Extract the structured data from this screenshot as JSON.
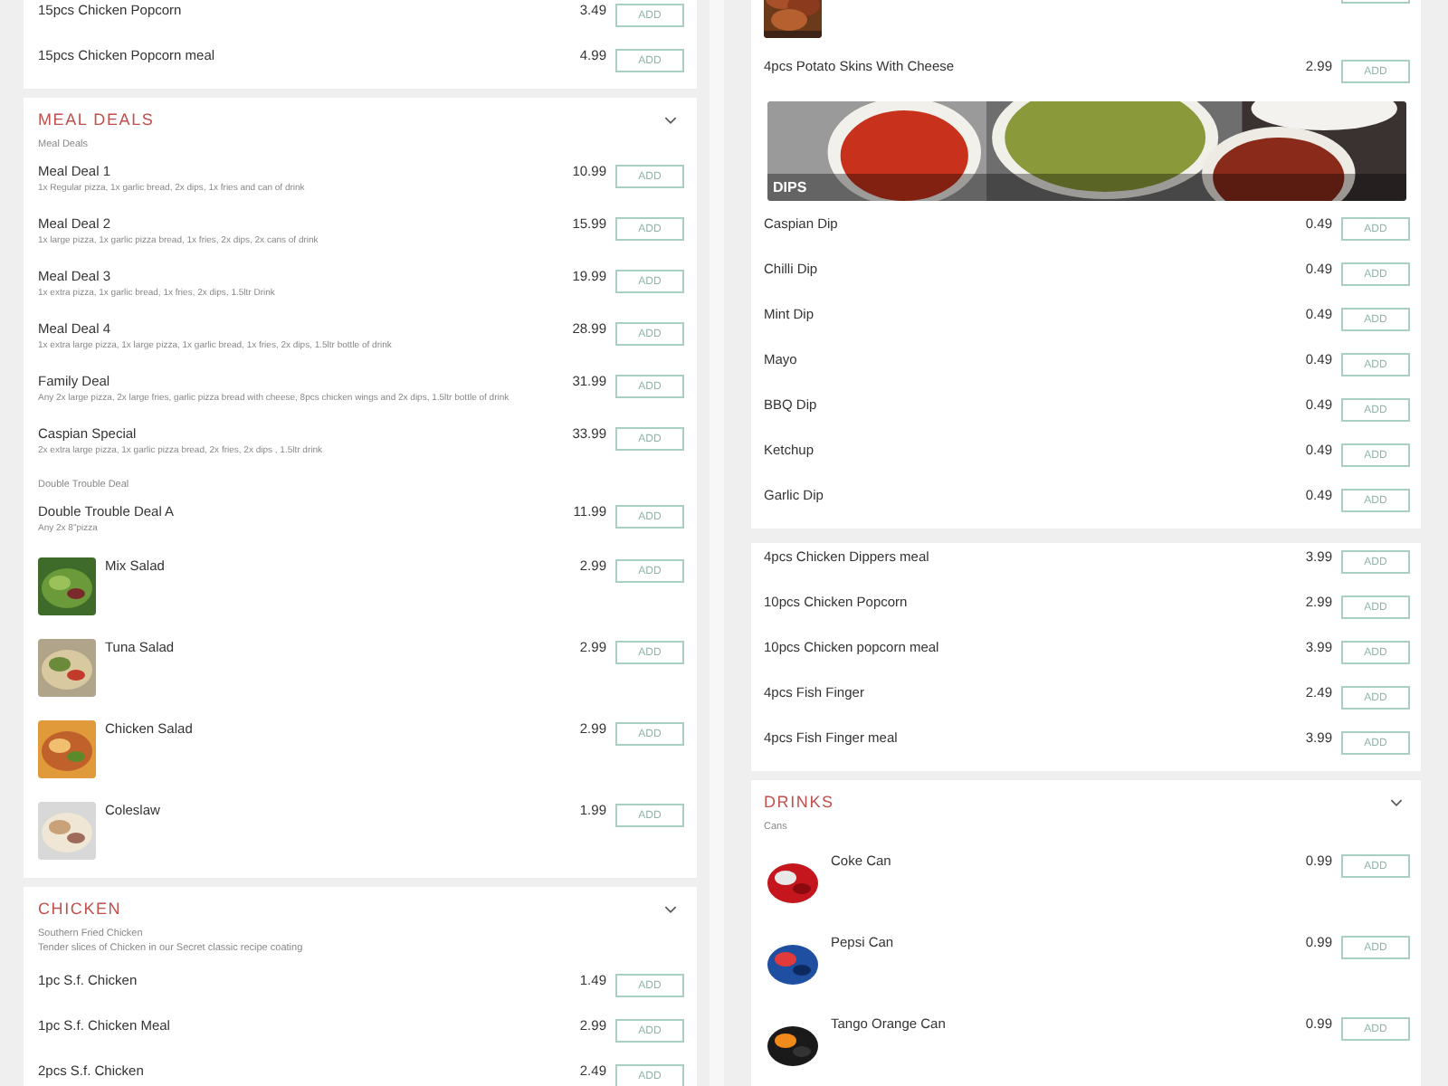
{
  "panels": [
    {
      "cards": [
        {
          "rows": [
            {
              "kind": "item",
              "name": "15pcs Chicken Popcorn",
              "price": "3.49",
              "button": "ADD"
            },
            {
              "kind": "item",
              "name": "15pcs Chicken Popcorn meal",
              "price": "4.99",
              "button": "ADD"
            }
          ]
        },
        {
          "title": "MEAL DEALS",
          "rows": [
            {
              "kind": "group",
              "text": "Meal Deals"
            },
            {
              "kind": "item",
              "name": "Meal Deal 1",
              "description": "1x Regular pizza, 1x garlic bread, 2x dips, 1x fries and can of drink",
              "price": "10.99",
              "button": "ADD"
            },
            {
              "kind": "item",
              "name": "Meal Deal 2",
              "description": "1x large pizza, 1x garlic pizza bread, 1x fries, 2x dips, 2x cans of drink",
              "price": "15.99",
              "button": "ADD"
            },
            {
              "kind": "item",
              "name": "Meal Deal 3",
              "description": "1x extra pizza, 1x garlic bread, 1x fries, 2x dips, 1.5ltr Drink",
              "price": "19.99",
              "button": "ADD"
            },
            {
              "kind": "item",
              "name": "Meal Deal 4",
              "description": "1x extra large pizza, 1x large pizza, 1x garlic bread, 1x fries, 2x dips, 1.5ltr bottle of drink",
              "price": "28.99",
              "button": "ADD"
            },
            {
              "kind": "item",
              "name": "Family Deal",
              "description": "Any 2x large pizza, 2x large fries, garlic pizza bread with cheese, 8pcs chicken wings and 2x dips, 1.5ltr bottle of drink",
              "price": "31.99",
              "button": "ADD"
            },
            {
              "kind": "item",
              "name": "Caspian Special",
              "description": "2x extra large pizza, 1x garlic pizza bread, 2x fries, 2x dips , 1.5ltr drink",
              "price": "33.99",
              "button": "ADD"
            },
            {
              "kind": "group",
              "text": "Double Trouble Deal"
            },
            {
              "kind": "item",
              "name": "Double Trouble Deal A",
              "description": "Any 2x 8\"pizza",
              "price": "11.99",
              "button": "ADD"
            }
          ]
        }
      ]
    },
    {
      "cards": [
        {
          "rows": [
            {
              "kind": "photo-only"
            },
            {
              "kind": "item",
              "name": "4pcs Potato Skins With Cheese",
              "price": "2.99",
              "button": "ADD"
            },
            {
              "kind": "banner",
              "label": "DIPS"
            },
            {
              "kind": "item",
              "name": "Caspian Dip",
              "price": "0.49",
              "button": "ADD"
            },
            {
              "kind": "item",
              "name": "Chilli Dip",
              "price": "0.49",
              "button": "ADD"
            },
            {
              "kind": "item",
              "name": "Mint Dip",
              "price": "0.49",
              "button": "ADD"
            },
            {
              "kind": "item",
              "name": "Mayo",
              "price": "0.49",
              "button": "ADD"
            },
            {
              "kind": "item",
              "name": "BBQ Dip",
              "price": "0.49",
              "button": "ADD"
            },
            {
              "kind": "item",
              "name": "Ketchup",
              "price": "0.49",
              "button": "ADD"
            },
            {
              "kind": "item",
              "name": "Garlic Dip",
              "price": "0.49",
              "button": "ADD"
            }
          ]
        }
      ]
    },
    {
      "cards": [
        {
          "rows": [
            {
              "kind": "photo-item",
              "name": "Mix Salad",
              "price": "2.99",
              "button": "ADD"
            },
            {
              "kind": "photo-item",
              "name": "Tuna Salad",
              "price": "2.99",
              "button": "ADD"
            },
            {
              "kind": "photo-item",
              "name": "Chicken Salad",
              "price": "2.99",
              "button": "ADD"
            },
            {
              "kind": "photo-item",
              "name": "Coleslaw",
              "price": "1.99",
              "button": "ADD"
            }
          ]
        },
        {
          "title": "CHICKEN",
          "rows": [
            {
              "kind": "group",
              "text": "Southern Fried Chicken",
              "note": "Tender slices of Chicken in our Secret classic recipe coating"
            },
            {
              "kind": "item",
              "name": "1pc S.f. Chicken",
              "price": "1.49",
              "button": "ADD"
            },
            {
              "kind": "item",
              "name": "1pc S.f. Chicken Meal",
              "price": "2.99",
              "button": "ADD"
            },
            {
              "kind": "item",
              "name": "2pcs S.f. Chicken",
              "price": "2.49",
              "button": "ADD"
            }
          ]
        }
      ]
    },
    {
      "cards": [
        {
          "rows": [
            {
              "kind": "item",
              "name": "4pcs Chicken Dippers meal",
              "price": "3.99",
              "button": "ADD"
            },
            {
              "kind": "item",
              "name": "10pcs Chicken Popcorn",
              "price": "2.99",
              "button": "ADD"
            },
            {
              "kind": "item",
              "name": "10pcs Chicken popcorn meal",
              "price": "3.99",
              "button": "ADD"
            },
            {
              "kind": "item",
              "name": "4pcs Fish Finger",
              "price": "2.49",
              "button": "ADD"
            },
            {
              "kind": "item",
              "name": "4pcs Fish Finger meal",
              "price": "3.99",
              "button": "ADD"
            }
          ]
        },
        {
          "title": "DRINKS",
          "rows": [
            {
              "kind": "group",
              "text": "Cans"
            },
            {
              "kind": "photo-item",
              "name": "Coke Can",
              "price": "0.99",
              "button": "ADD"
            },
            {
              "kind": "photo-item",
              "name": "Pepsi Can",
              "price": "0.99",
              "button": "ADD"
            },
            {
              "kind": "photo-item",
              "name": "Tango Orange Can",
              "price": "0.99",
              "button": "ADD"
            }
          ]
        }
      ]
    }
  ]
}
